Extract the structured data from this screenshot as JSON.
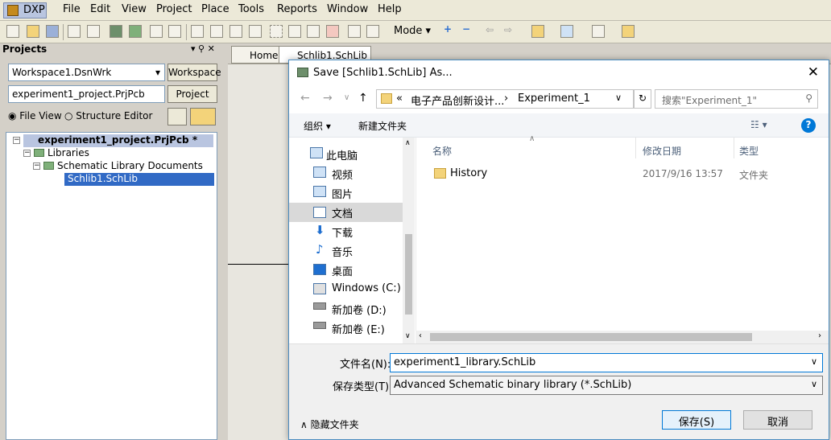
{
  "menubar": {
    "dxp": "DXP",
    "items": [
      "File",
      "Edit",
      "View",
      "Project",
      "Place",
      "Tools",
      "Reports",
      "Window",
      "Help"
    ]
  },
  "toolbar": {
    "mode_label": "Mode"
  },
  "panel": {
    "title": "Projects",
    "workspace_value": "Workspace1.DsnWrk",
    "workspace_button": "Workspace",
    "project_value": "experiment1_project.PrjPcb",
    "project_button": "Project",
    "radio_file_view": "File View",
    "radio_structure": "Structure Editor",
    "tree": {
      "project": "experiment1_project.PrjPcb *",
      "libraries": "Libraries",
      "schlib_docs": "Schematic Library Documents",
      "schlib_file": "Schlib1.SchLib"
    }
  },
  "doc_tabs": [
    "Home",
    "Schlib1.SchLib"
  ],
  "dialog": {
    "title": "Save [Schlib1.SchLib] As...",
    "close": "✕",
    "breadcrumb": [
      "«",
      "电子产品创新设计...",
      "Experiment_1"
    ],
    "search_placeholder": "搜索\"Experiment_1\"",
    "organize": "组织",
    "new_folder": "新建文件夹",
    "nav_items": [
      "此电脑",
      "视频",
      "图片",
      "文档",
      "下载",
      "音乐",
      "桌面",
      "Windows (C:)",
      "新加卷 (D:)",
      "新加卷 (E:)"
    ],
    "columns": [
      "名称",
      "修改日期",
      "类型"
    ],
    "files": [
      {
        "name": "History",
        "date": "2017/9/16 13:57",
        "type": "文件夹"
      }
    ],
    "filename_label": "文件名(N):",
    "filename_value": "experiment1_library.SchLib",
    "filetype_label": "保存类型(T):",
    "filetype_value": "Advanced Schematic binary library (*.SchLib)",
    "hide_folders": "隐藏文件夹",
    "save_button": "保存(S)",
    "cancel_button": "取消"
  },
  "colors": {
    "accent": "#0078d7",
    "selection": "#316ac5",
    "dialog_border": "#4a8bbf"
  }
}
